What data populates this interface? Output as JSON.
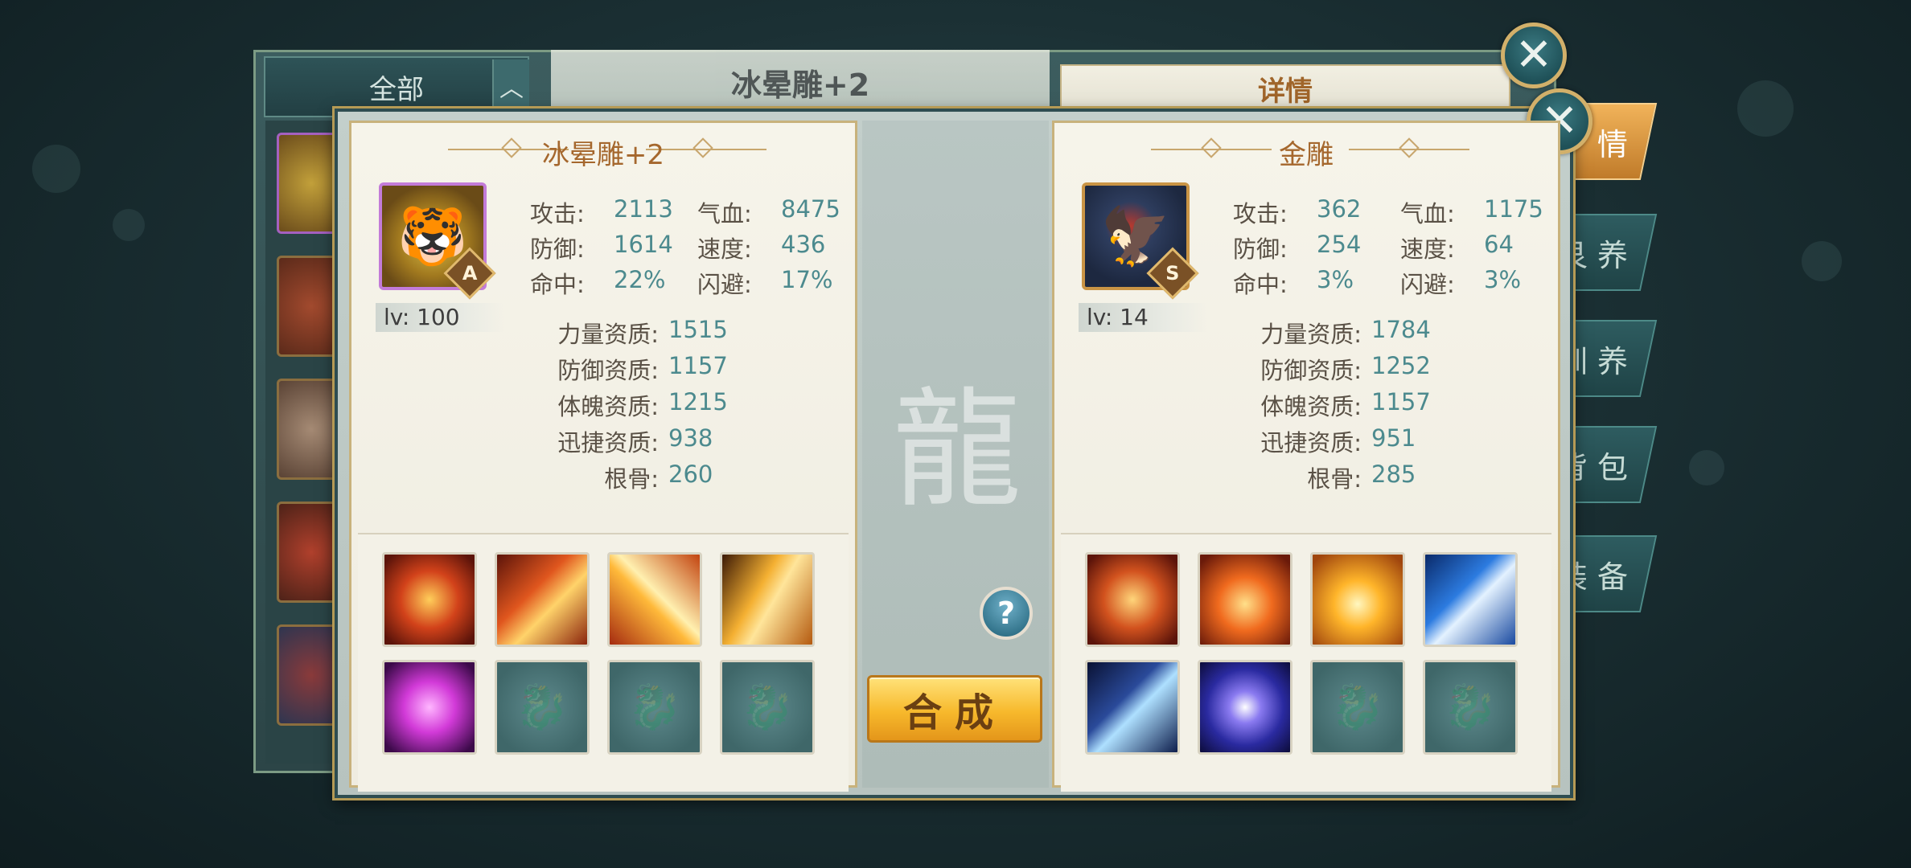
{
  "background_panel": {
    "filter_label": "全部",
    "filter_arrow": "︿",
    "title": "冰晕雕+2",
    "detail_header": "详情",
    "side_tabs": [
      "情",
      "艮 养",
      "训 养",
      "背 包",
      "装 备"
    ]
  },
  "left_pet": {
    "name": "冰晕雕+2",
    "grade": "A",
    "level": "lv: 100",
    "stats": [
      {
        "label": "攻击:",
        "value": "2113"
      },
      {
        "label": "气血:",
        "value": "8475"
      },
      {
        "label": "防御:",
        "value": "1614"
      },
      {
        "label": "速度:",
        "value": "436"
      },
      {
        "label": "命中:",
        "value": "22%"
      },
      {
        "label": "闪避:",
        "value": "17%"
      }
    ],
    "aptitudes": [
      {
        "label": "力量资质:",
        "value": "1515"
      },
      {
        "label": "防御资质:",
        "value": "1157"
      },
      {
        "label": "体魄资质:",
        "value": "1215"
      },
      {
        "label": "迅捷资质:",
        "value": "938"
      },
      {
        "label": "根骨:",
        "value": "260"
      }
    ]
  },
  "right_pet": {
    "name": "金雕",
    "grade": "S",
    "level": "lv: 14",
    "stats": [
      {
        "label": "攻击:",
        "value": "362"
      },
      {
        "label": "气血:",
        "value": "1175"
      },
      {
        "label": "防御:",
        "value": "254"
      },
      {
        "label": "速度:",
        "value": "64"
      },
      {
        "label": "命中:",
        "value": "3%"
      },
      {
        "label": "闪避:",
        "value": "3%"
      }
    ],
    "aptitudes": [
      {
        "label": "力量资质:",
        "value": "1784"
      },
      {
        "label": "防御资质:",
        "value": "1252"
      },
      {
        "label": "体魄资质:",
        "value": "1157"
      },
      {
        "label": "迅捷资质:",
        "value": "951"
      },
      {
        "label": "根骨:",
        "value": "285"
      }
    ]
  },
  "actions": {
    "help": "?",
    "compose": "合成",
    "close": "✕"
  },
  "colors": {
    "accent_gold": "#f7b92c",
    "stat_value": "#4c8a8e",
    "title_brown": "#a5672d"
  }
}
